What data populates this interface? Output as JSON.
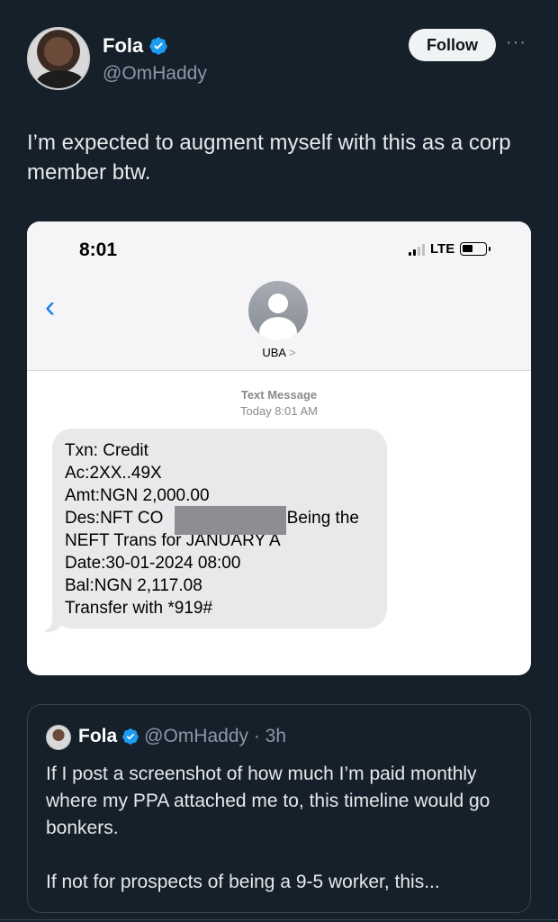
{
  "colors": {
    "background": "#15202b",
    "verified": "#1d9bf0",
    "ios_blue": "#1a7cf0",
    "muted_text": "#8b98a5"
  },
  "header": {
    "display_name": "Fola",
    "handle": "@OmHaddy",
    "follow_label": "Follow",
    "more_label": "···",
    "verified_icon": "verified-badge-icon"
  },
  "tweet": {
    "text": "I’m expected to augment myself with this as a corp member btw."
  },
  "media": {
    "status_bar": {
      "time": "8:01",
      "network": "LTE"
    },
    "contact": {
      "name": "UBA",
      "chevron": ">"
    },
    "message_meta": {
      "type": "Text Message",
      "timestamp": "Today 8:01 AM"
    },
    "sms_lines": [
      "Txn: Credit",
      "Ac:2XX..49X",
      "Amt:NGN 2,000.00",
      "Des:NFT CO                          Being the",
      "NEFT Trans for JANUARY A",
      "Date:30-01-2024 08:00",
      "Bal:NGN 2,117.08",
      "Transfer with *919#"
    ]
  },
  "quote": {
    "display_name": "Fola",
    "handle_time": "@OmHaddy · 3h",
    "paragraphs": [
      "If I post a screenshot of how much I’m paid monthly where my PPA attached me to, this timeline would go bonkers.",
      "If not for prospects of being a 9-5 worker, this..."
    ]
  }
}
